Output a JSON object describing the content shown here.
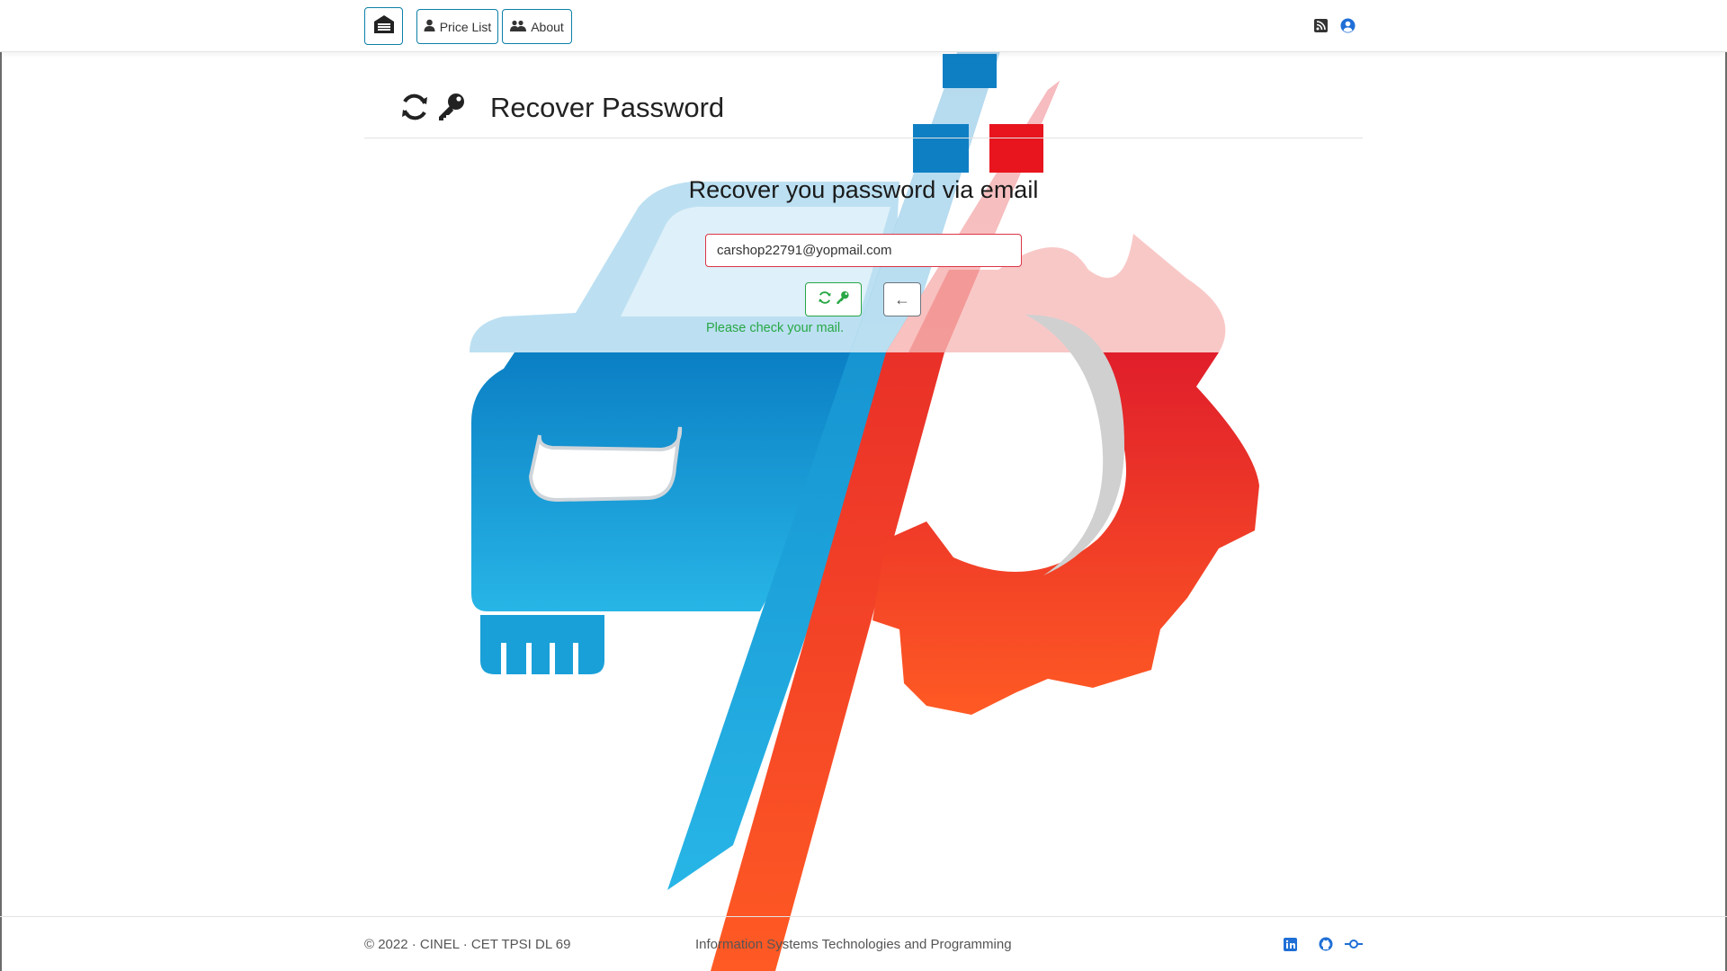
{
  "nav": {
    "home_icon": "warehouse-icon",
    "price_list_label": "Price List",
    "about_label": "About",
    "right_icons": [
      "rss-icon",
      "user-circle-icon"
    ]
  },
  "header": {
    "title": "Recover Password",
    "icons": [
      "sync-icon",
      "key-icon"
    ]
  },
  "form": {
    "heading": "Recover you password via email",
    "email_value": "carshop22791@yopmail.com",
    "recover_button_icons": [
      "sync-icon",
      "key-icon"
    ],
    "back_button_symbol": "←",
    "status_message": "Please check your mail."
  },
  "footer": {
    "copyright": "© 2022 · CINEL · CET TPSI DL 69",
    "tagline": "Information Systems Technologies and Programming",
    "icons": [
      "linkedin-icon",
      "github-icon",
      "git-commit-icon"
    ]
  },
  "colors": {
    "blue": "#0f8fd0",
    "red": "#e53935",
    "success": "#28a745",
    "danger": "#dc3545",
    "link_blue": "#1f6fd6"
  }
}
